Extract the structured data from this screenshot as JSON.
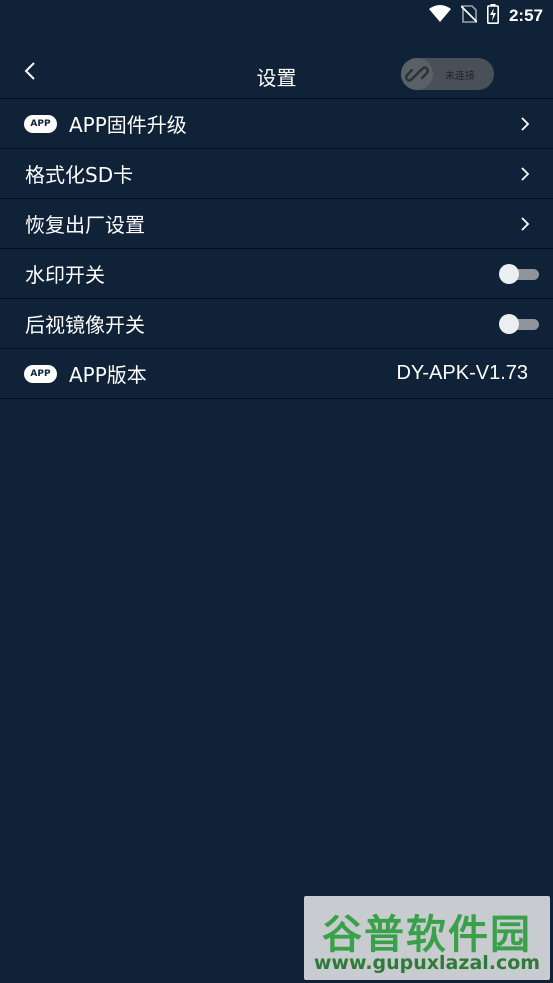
{
  "status_bar": {
    "time": "2:57",
    "icons": [
      "wifi-icon",
      "no-sim-icon",
      "battery-charging-icon"
    ]
  },
  "header": {
    "title": "设置",
    "back_icon": "chevron-left-icon",
    "connection": {
      "icon": "link-icon",
      "status": "未连接"
    }
  },
  "settings": [
    {
      "label": "APP固件升级",
      "badge": "APP",
      "control": "chevron-right-icon"
    },
    {
      "label": "格式化SD卡",
      "control": "chevron-right-icon"
    },
    {
      "label": "恢复出厂设置",
      "control": "chevron-right-icon"
    },
    {
      "label": "水印开关",
      "control": "toggle",
      "on": false
    },
    {
      "label": "后视镜像开关",
      "control": "toggle",
      "on": false
    },
    {
      "label": "APP版本",
      "badge": "APP",
      "value": "DY-APK-V1.73"
    }
  ],
  "watermark": {
    "title": "谷普软件园",
    "url": "www.gupuxlazal.com"
  },
  "colors": {
    "background": "#0f2237",
    "divider": "#050d16",
    "text": "#ffffff",
    "toggle_track": "#8e949a",
    "toggle_thumb": "#eceff1",
    "watermark_green": "#3aa14a"
  }
}
